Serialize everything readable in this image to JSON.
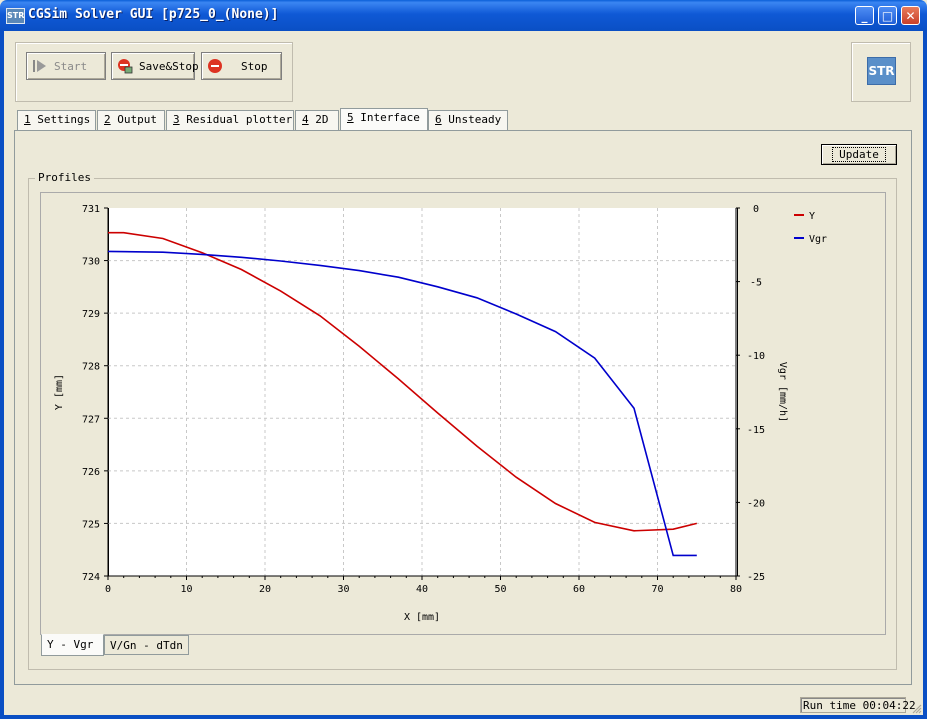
{
  "window": {
    "title": "CGSim Solver GUI [p725_0_(None)]",
    "icon": "STR",
    "buttons": {
      "minimize": "_",
      "maximize": "□",
      "close": "✕"
    }
  },
  "toolbar": {
    "start_label": "Start",
    "savestop_label": "Save&Stop",
    "stop_label": "Stop"
  },
  "logo_text": "STR",
  "tabs": [
    {
      "num": "1",
      "label": " Settings"
    },
    {
      "num": "2",
      "label": " Output"
    },
    {
      "num": "3",
      "label": " Residual plotter"
    },
    {
      "num": "4",
      "label": " 2D"
    },
    {
      "num": "5",
      "label": " Interface"
    },
    {
      "num": "6",
      "label": " Unsteady"
    }
  ],
  "active_tab": 4,
  "update_label": "Update",
  "profiles_label": "Profiles",
  "bottom_tabs": [
    "Y - Vgr",
    "V/Gn - dTdn"
  ],
  "status": {
    "runtime": "Run time 00:04:22"
  },
  "colors": {
    "series_y": "#cc0000",
    "series_vgr": "#0000cc",
    "grid": "#c8c8c8"
  },
  "chart_data": {
    "type": "line",
    "xlabel": "X [mm]",
    "ylabel": "Y [mm]",
    "y2label": "Vgr [mm/h]",
    "xlim": [
      0,
      80
    ],
    "ylim": [
      724,
      731
    ],
    "y2lim": [
      -25,
      0
    ],
    "xticks": [
      "0",
      "10",
      "20",
      "30",
      "40",
      "50",
      "60",
      "70",
      "80"
    ],
    "yticks": [
      "724",
      "725",
      "726",
      "727",
      "728",
      "729",
      "730",
      "731"
    ],
    "y2ticks": [
      "-25",
      "-20",
      "-15",
      "-10",
      "-5",
      "0"
    ],
    "grid": true,
    "legend_position": "top-right",
    "series": [
      {
        "name": "Y",
        "axis": "left",
        "color": "#cc0000",
        "x": [
          0,
          2,
          7,
          12,
          17,
          22,
          27,
          32,
          37,
          42,
          47,
          52,
          57,
          62,
          67,
          72,
          75
        ],
        "y": [
          730.53,
          730.53,
          730.42,
          730.15,
          729.83,
          729.42,
          728.95,
          728.37,
          727.75,
          727.1,
          726.47,
          725.88,
          725.38,
          725.02,
          724.86,
          724.89,
          725.0
        ]
      },
      {
        "name": "Vgr",
        "axis": "right",
        "color": "#0000cc",
        "x": [
          0,
          7,
          12,
          17,
          22,
          27,
          32,
          37,
          42,
          47,
          52,
          57,
          62,
          67,
          72,
          75
        ],
        "y": [
          -2.95,
          -3.0,
          -3.15,
          -3.35,
          -3.6,
          -3.9,
          -4.25,
          -4.7,
          -5.35,
          -6.1,
          -7.2,
          -8.4,
          -10.2,
          -13.6,
          -23.6,
          -23.6
        ]
      }
    ]
  }
}
